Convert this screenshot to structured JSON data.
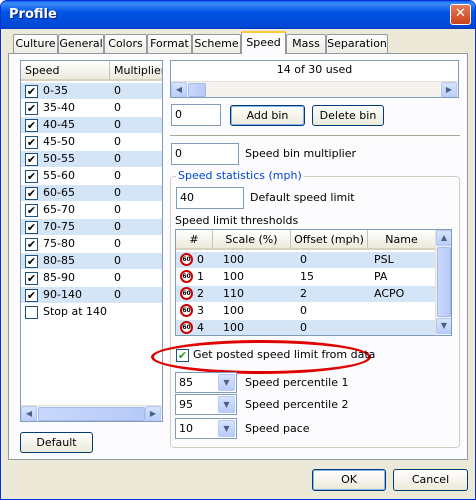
{
  "window": {
    "title": "Profile",
    "close_glyph": "✕"
  },
  "tabs": [
    "Culture",
    "General",
    "Colors",
    "Format",
    "Scheme",
    "Speed",
    "Mass",
    "Separation"
  ],
  "active_tab": "Speed",
  "speed_list": {
    "col_speed": "Speed",
    "col_multiplier": "Multiplier",
    "rows": [
      {
        "label": "0-35",
        "mult": "0",
        "checked": true
      },
      {
        "label": "35-40",
        "mult": "0",
        "checked": true
      },
      {
        "label": "40-45",
        "mult": "0",
        "checked": true
      },
      {
        "label": "45-50",
        "mult": "0",
        "checked": true
      },
      {
        "label": "50-55",
        "mult": "0",
        "checked": true
      },
      {
        "label": "55-60",
        "mult": "0",
        "checked": true
      },
      {
        "label": "60-65",
        "mult": "0",
        "checked": true
      },
      {
        "label": "65-70",
        "mult": "0",
        "checked": true
      },
      {
        "label": "70-75",
        "mult": "0",
        "checked": true
      },
      {
        "label": "75-80",
        "mult": "0",
        "checked": true
      },
      {
        "label": "80-85",
        "mult": "0",
        "checked": true
      },
      {
        "label": "85-90",
        "mult": "0",
        "checked": true
      },
      {
        "label": "90-140",
        "mult": "0",
        "checked": true
      },
      {
        "label": "Stop at 140",
        "mult": "",
        "checked": false
      }
    ]
  },
  "used_text": "14 of 30 used",
  "bin_input": "0",
  "add_bin": "Add bin",
  "delete_bin": "Delete bin",
  "multiplier_input": "0",
  "multiplier_label": "Speed bin multiplier",
  "stats": {
    "group_title": "Speed statistics (mph)",
    "default_limit_value": "40",
    "default_limit_label": "Default speed limit",
    "thresholds_label": "Speed limit thresholds",
    "columns": [
      "#",
      "Scale (%)",
      "Offset (mph)",
      "Name"
    ],
    "sign_text": "60",
    "rows": [
      {
        "n": "0",
        "scale": "100",
        "offset": "0",
        "name": "PSL"
      },
      {
        "n": "1",
        "scale": "100",
        "offset": "15",
        "name": "PA"
      },
      {
        "n": "2",
        "scale": "110",
        "offset": "2",
        "name": "ACPO"
      },
      {
        "n": "3",
        "scale": "100",
        "offset": "0",
        "name": ""
      },
      {
        "n": "4",
        "scale": "100",
        "offset": "0",
        "name": ""
      }
    ],
    "posted_checkbox": "Get posted speed limit from data",
    "percentile1_value": "85",
    "percentile1_label": "Speed percentile 1",
    "percentile2_value": "95",
    "percentile2_label": "Speed percentile 2",
    "pace_value": "10",
    "pace_label": "Speed pace"
  },
  "default_button": "Default",
  "ok_button": "OK",
  "cancel_button": "Cancel",
  "colors": {
    "highlight_ellipse": "#e00000",
    "selection": "#d4e5f7",
    "title_bar": "#0054e3"
  }
}
